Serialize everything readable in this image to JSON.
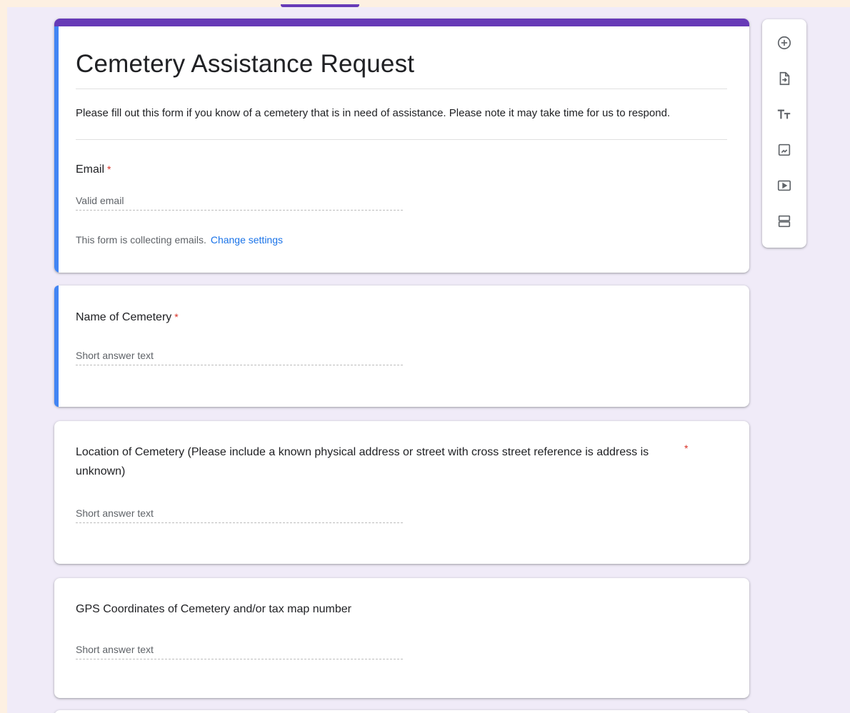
{
  "form": {
    "title": "Cemetery Assistance Request",
    "description": "Please fill out this form if you know of a cemetery that is in need of assistance. Please note it may take time for us to respond.",
    "email": {
      "label": "Email",
      "required_mark": "*",
      "placeholder": "Valid email",
      "collecting_note": "This form is collecting emails.",
      "change_settings_link": "Change settings"
    }
  },
  "questions": [
    {
      "label": "Name of Cemetery",
      "required_mark": "*",
      "placeholder": "Short answer text"
    },
    {
      "label": "Location of Cemetery (Please include a known physical address or street with cross street reference is address is unknown)",
      "required_mark": "*",
      "placeholder": "Short answer text"
    },
    {
      "label": "GPS Coordinates of Cemetery and/or tax map number",
      "placeholder": "Short answer text"
    }
  ],
  "toolbar": {
    "icons": [
      "add-question-icon",
      "import-questions-icon",
      "add-title-icon",
      "add-image-icon",
      "add-video-icon",
      "add-section-icon"
    ]
  },
  "colors": {
    "accent_purple": "#673ab7",
    "active_blue": "#4285f4",
    "required_red": "#d93025",
    "link_blue": "#1a73e8",
    "background": "#f0ebf8"
  }
}
